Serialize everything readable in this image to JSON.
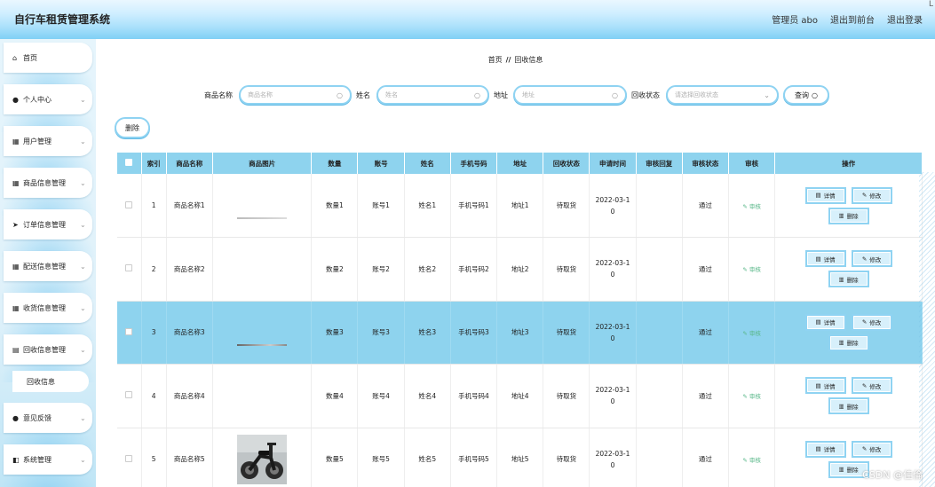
{
  "header": {
    "title": "自行车租赁管理系统",
    "user_label": "管理员 abo",
    "back_label": "退出到前台",
    "logout_label": "退出登录",
    "corner": "L"
  },
  "sidebar": {
    "items": [
      {
        "icon": "home-icon",
        "glyph": "⌂",
        "label": "首页"
      },
      {
        "icon": "user-icon",
        "glyph": "●",
        "label": "个人中心"
      },
      {
        "icon": "grid-icon",
        "glyph": "▦",
        "label": "用户管理"
      },
      {
        "icon": "grid-icon",
        "glyph": "▦",
        "label": "商品信息管理"
      },
      {
        "icon": "send-icon",
        "glyph": "➤",
        "label": "订单信息管理"
      },
      {
        "icon": "grid-icon",
        "glyph": "▦",
        "label": "配送信息管理"
      },
      {
        "icon": "grid-icon",
        "glyph": "▦",
        "label": "收货信息管理"
      },
      {
        "icon": "doc-icon",
        "glyph": "▤",
        "label": "回收信息管理"
      },
      {
        "icon": "user-icon",
        "glyph": "●",
        "label": "意见反馈"
      },
      {
        "icon": "tools-icon",
        "glyph": "◧",
        "label": "系统管理"
      }
    ],
    "sub_item": "回收信息"
  },
  "breadcrumb": {
    "home": "首页",
    "separator": "//",
    "current": "回收信息"
  },
  "search": {
    "product_label": "商品名称",
    "product_placeholder": "商品名称",
    "name_label": "姓名",
    "name_placeholder": "姓名",
    "address_label": "地址",
    "address_placeholder": "地址",
    "status_label": "回收状态",
    "status_placeholder": "请选择回收状态",
    "query_label": "查询"
  },
  "actions": {
    "delete_label": "删除"
  },
  "table": {
    "headers": [
      "索引",
      "商品名称",
      "商品图片",
      "数量",
      "账号",
      "姓名",
      "手机号码",
      "地址",
      "回收状态",
      "申请时间",
      "审核回复",
      "审核状态",
      "审核",
      "操作"
    ],
    "review_label": "审核",
    "detail_label": "详情",
    "edit_label": "修改",
    "delete_label": "删除",
    "rows": [
      {
        "idx": "1",
        "product": "商品名称1",
        "qty": "数量1",
        "account": "账号1",
        "name": "姓名1",
        "phone": "手机号码1",
        "address": "地址1",
        "status": "待取货",
        "date1": "2022-03-1",
        "date2": "0",
        "reply": "",
        "audit": "通过",
        "image": "none",
        "selected": false
      },
      {
        "idx": "2",
        "product": "商品名称2",
        "qty": "数量2",
        "account": "账号2",
        "name": "姓名2",
        "phone": "手机号码2",
        "address": "地址2",
        "status": "待取货",
        "date1": "2022-03-1",
        "date2": "0",
        "reply": "",
        "audit": "通过",
        "image": "line",
        "selected": false
      },
      {
        "idx": "3",
        "product": "商品名称3",
        "qty": "数量3",
        "account": "账号3",
        "name": "姓名3",
        "phone": "手机号码3",
        "address": "地址3",
        "status": "待取货",
        "date1": "2022-03-1",
        "date2": "0",
        "reply": "",
        "audit": "通过",
        "image": "none",
        "selected": true
      },
      {
        "idx": "4",
        "product": "商品名称4",
        "qty": "数量4",
        "account": "账号4",
        "name": "姓名4",
        "phone": "手机号码4",
        "address": "地址4",
        "status": "待取货",
        "date1": "2022-03-1",
        "date2": "0",
        "reply": "",
        "audit": "通过",
        "image": "dark-line",
        "selected": false
      },
      {
        "idx": "5",
        "product": "商品名称5",
        "qty": "数量5",
        "account": "账号5",
        "name": "姓名5",
        "phone": "手机号码5",
        "address": "地址5",
        "status": "待取货",
        "date1": "2022-03-1",
        "date2": "0",
        "reply": "",
        "audit": "通过",
        "image": "bike",
        "selected": false
      }
    ]
  },
  "watermark": "CSDN @佳倫",
  "colors": {
    "header_bg": "#a9e0fb",
    "table_header": "#8ed3ee",
    "selected_row": "#8ed3ee",
    "button_border": "#8fd3f2",
    "review_link": "#5ab88a"
  }
}
